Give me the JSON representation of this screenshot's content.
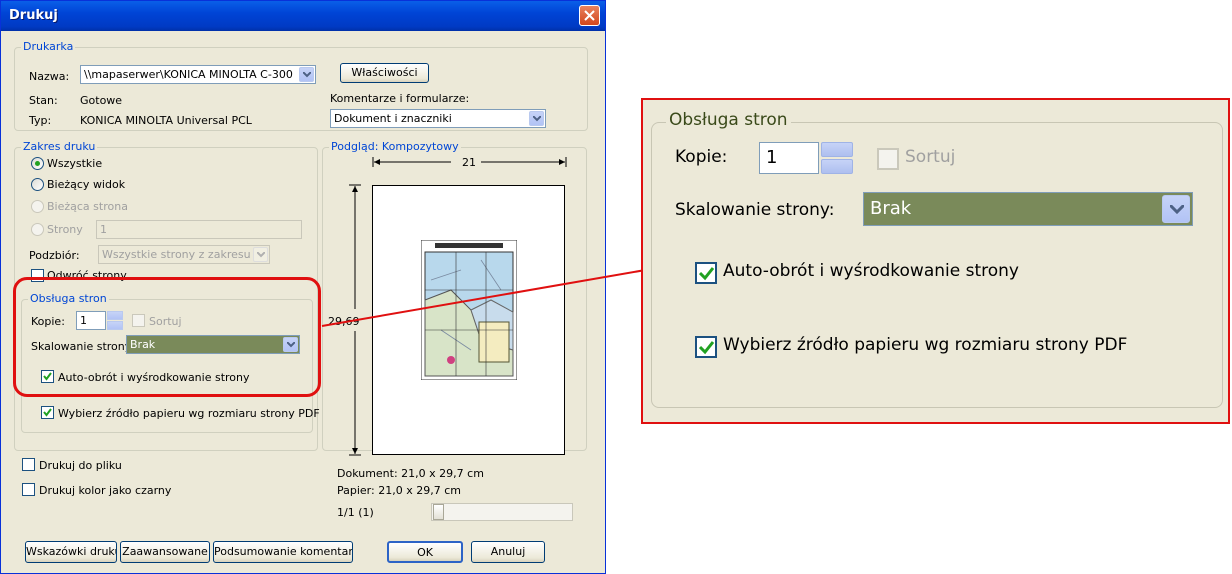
{
  "dialog": {
    "title": "Drukuj",
    "printer": {
      "legend": "Drukarka",
      "name_label": "Nazwa:",
      "name_value": "\\\\mapaserwer\\KONICA MINOLTA C-300",
      "status_label": "Stan:",
      "status_value": "Gotowe",
      "type_label": "Typ:",
      "type_value": "KONICA MINOLTA Universal PCL",
      "properties_button": "Właściwości",
      "comments_label": "Komentarze i formularze:",
      "comments_value": "Dokument i znaczniki"
    },
    "range": {
      "legend": "Zakres druku",
      "all": "Wszystkie",
      "current_view": "Bieżący widok",
      "current_page": "Bieżąca strona",
      "pages": "Strony",
      "pages_value": "1",
      "subset_label": "Podzbiór:",
      "subset_value": "Wszystkie strony z zakresu",
      "reverse": "Odwróć strony"
    },
    "handling": {
      "legend": "Obsługa stron",
      "copies_label": "Kopie:",
      "copies_value": "1",
      "collate": "Sortuj",
      "scaling_label": "Skalowanie strony:",
      "scaling_value": "Brak",
      "auto_rotate": "Auto-obrót i wyśrodkowanie strony",
      "paper_source": "Wybierz źródło papieru wg rozmiaru strony PDF"
    },
    "preview": {
      "legend": "Podgląd: Kompozytowy",
      "width": "21",
      "height": "29,69",
      "document": "Dokument: 21,0 x 29,7 cm",
      "paper": "Papier: 21,0 x 29,7 cm",
      "page_counter": "1/1 (1)"
    },
    "print_to_file": "Drukuj do pliku",
    "print_color_as_black": "Drukuj kolor jako czarny",
    "buttons": {
      "tips": "Wskazówki druku",
      "advanced": "Zaawansowane",
      "summarize": "Podsumowanie komentarzy",
      "ok": "OK",
      "cancel": "Anuluj"
    }
  },
  "zoom": {
    "legend": "Obsługa stron",
    "copies_label": "Kopie:",
    "copies_value": "1",
    "collate": "Sortuj",
    "scaling_label": "Skalowanie strony:",
    "scaling_value": "Brak",
    "auto_rotate": "Auto-obrót i wyśrodkowanie strony",
    "paper_source": "Wybierz źródło papieru wg rozmiaru strony PDF"
  },
  "colors": {
    "highlight": "#e01010",
    "titlebar": "#0044d6",
    "dialog_bg": "#ece9d8",
    "selected_combo": "#7a8a5a",
    "check_mark": "#21a121"
  }
}
